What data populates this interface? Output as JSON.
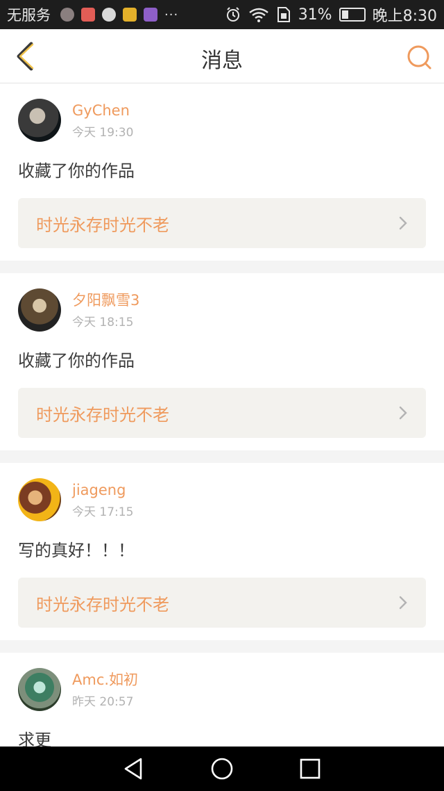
{
  "status_bar": {
    "carrier": "无服务",
    "more": "···",
    "battery_percent": "31%",
    "time": "晚上8:30",
    "battery_level": 0.31
  },
  "header": {
    "title": "消息",
    "back_icon": "chevron-left-icon",
    "search_icon": "search-icon",
    "accent_color": "#ef9a5d"
  },
  "messages": [
    {
      "username": "GyChen",
      "time": "今天 19:30",
      "text": "收藏了你的作品",
      "work_title": "时光永存时光不老"
    },
    {
      "username": "夕阳飘雪3",
      "time": "今天 18:15",
      "text": "收藏了你的作品",
      "work_title": "时光永存时光不老"
    },
    {
      "username": "jiageng",
      "time": "今天 17:15",
      "text": "写的真好！！！",
      "work_title": "时光永存时光不老"
    },
    {
      "username": "Amc.如初",
      "time": "昨天 20:57",
      "text": "求更",
      "work_title": ""
    }
  ],
  "nav_bar": {
    "back_icon": "triangle-back-icon",
    "home_icon": "circle-home-icon",
    "recent_icon": "square-recent-icon"
  }
}
